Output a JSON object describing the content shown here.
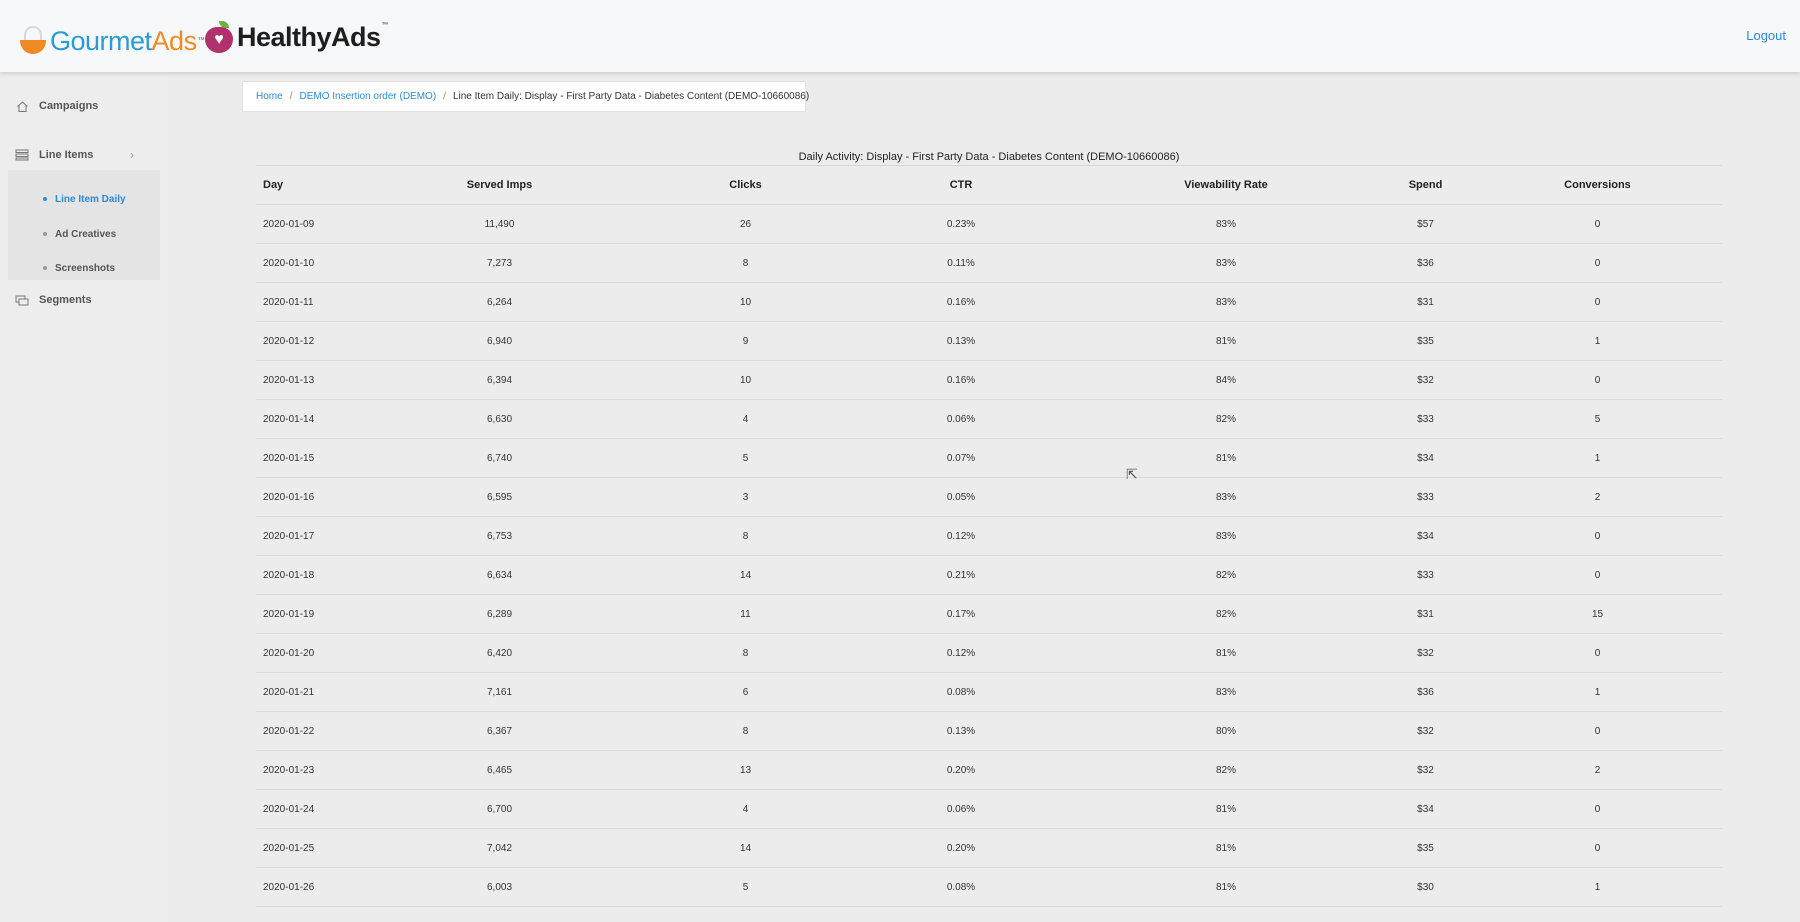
{
  "header": {
    "brand_gourmet_part1": "Gourmet",
    "brand_gourmet_part2": "Ads",
    "brand_healthy": "HealthyAds",
    "trademark": "™",
    "logout_label": "Logout"
  },
  "sidebar": {
    "items": [
      {
        "label": "Campaigns",
        "icon": "home-icon"
      },
      {
        "label": "Line Items",
        "icon": "list-icon"
      },
      {
        "label": "Segments",
        "icon": "layers-icon"
      }
    ],
    "subitems": [
      {
        "label": "Line Item Daily",
        "active": true
      },
      {
        "label": "Ad Creatives",
        "active": false
      },
      {
        "label": "Screenshots",
        "active": false
      }
    ]
  },
  "breadcrumb": {
    "home": "Home",
    "order": "DEMO Insertion order (DEMO)",
    "current": "Line Item Daily: Display - First Party Data - Diabetes Content (DEMO-10660086)",
    "separator": "/"
  },
  "table": {
    "title": "Daily Activity: Display - First Party Data - Diabetes Content (DEMO-10660086)",
    "columns": [
      "Day",
      "Served Imps",
      "Clicks",
      "CTR",
      "Viewability Rate",
      "Spend",
      "Conversions"
    ],
    "rows": [
      [
        "2020-01-09",
        "11,490",
        "26",
        "0.23%",
        "83%",
        "$57",
        "0"
      ],
      [
        "2020-01-10",
        "7,273",
        "8",
        "0.11%",
        "83%",
        "$36",
        "0"
      ],
      [
        "2020-01-11",
        "6,264",
        "10",
        "0.16%",
        "83%",
        "$31",
        "0"
      ],
      [
        "2020-01-12",
        "6,940",
        "9",
        "0.13%",
        "81%",
        "$35",
        "1"
      ],
      [
        "2020-01-13",
        "6,394",
        "10",
        "0.16%",
        "84%",
        "$32",
        "0"
      ],
      [
        "2020-01-14",
        "6,630",
        "4",
        "0.06%",
        "82%",
        "$33",
        "5"
      ],
      [
        "2020-01-15",
        "6,740",
        "5",
        "0.07%",
        "81%",
        "$34",
        "1"
      ],
      [
        "2020-01-16",
        "6,595",
        "3",
        "0.05%",
        "83%",
        "$33",
        "2"
      ],
      [
        "2020-01-17",
        "6,753",
        "8",
        "0.12%",
        "83%",
        "$34",
        "0"
      ],
      [
        "2020-01-18",
        "6,634",
        "14",
        "0.21%",
        "82%",
        "$33",
        "0"
      ],
      [
        "2020-01-19",
        "6,289",
        "11",
        "0.17%",
        "82%",
        "$31",
        "15"
      ],
      [
        "2020-01-20",
        "6,420",
        "8",
        "0.12%",
        "81%",
        "$32",
        "0"
      ],
      [
        "2020-01-21",
        "7,161",
        "6",
        "0.08%",
        "83%",
        "$36",
        "1"
      ],
      [
        "2020-01-22",
        "6,367",
        "8",
        "0.13%",
        "80%",
        "$32",
        "0"
      ],
      [
        "2020-01-23",
        "6,465",
        "13",
        "0.20%",
        "82%",
        "$32",
        "2"
      ],
      [
        "2020-01-24",
        "6,700",
        "4",
        "0.06%",
        "81%",
        "$34",
        "0"
      ],
      [
        "2020-01-25",
        "7,042",
        "14",
        "0.20%",
        "81%",
        "$35",
        "0"
      ],
      [
        "2020-01-26",
        "6,003",
        "5",
        "0.08%",
        "81%",
        "$30",
        "1"
      ]
    ]
  },
  "colors": {
    "accent": "#2b8bd6",
    "brand_orange": "#f08a24",
    "brand_blue": "#2b9bd3",
    "brand_plum": "#b0316b"
  }
}
